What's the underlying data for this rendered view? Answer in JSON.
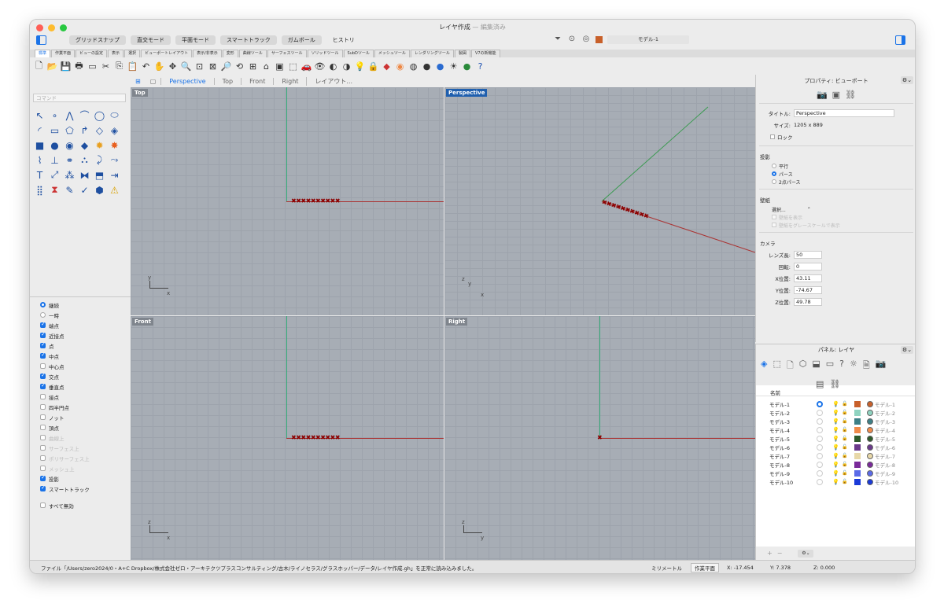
{
  "window": {
    "title": "レイヤ作成",
    "subtitle": "— 編集済み"
  },
  "modes": [
    "グリッドスナップ",
    "直交モード",
    "平面モード",
    "スマートトラック",
    "ガムボール"
  ],
  "history_label": "ヒストリ",
  "current_layer": "モデル-1",
  "tabs": [
    "標準",
    "作業平面",
    "ビューの設定",
    "表示",
    "選択",
    "ビューポートレイアウト",
    "表示/非表示",
    "変形",
    "曲線ツール",
    "サーフェスツール",
    "ソリッドツール",
    "SubDツール",
    "メッシュツール",
    "レンダリングツール",
    "製図",
    "V7の新機能"
  ],
  "command_placeholder": "コマンド",
  "viewport_tabs": [
    "Perspective",
    "Top",
    "Front",
    "Right",
    "レイアウト..."
  ],
  "viewports": {
    "top": "Top",
    "perspective": "Perspective",
    "front": "Front",
    "right": "Right"
  },
  "gizmo": {
    "top": [
      "y",
      "x"
    ],
    "persp": [
      "z",
      "y",
      "x"
    ],
    "front": [
      "z",
      "x"
    ],
    "right": [
      "z",
      "y"
    ]
  },
  "osnap": [
    {
      "label": "継続",
      "type": "radio",
      "on": true
    },
    {
      "label": "一時",
      "type": "radio",
      "on": false
    },
    {
      "label": "端点",
      "type": "check",
      "on": true
    },
    {
      "label": "近接点",
      "type": "check",
      "on": true
    },
    {
      "label": "点",
      "type": "check",
      "on": true
    },
    {
      "label": "中点",
      "type": "check",
      "on": true
    },
    {
      "label": "中心点",
      "type": "check",
      "on": false
    },
    {
      "label": "交点",
      "type": "check",
      "on": true
    },
    {
      "label": "垂直点",
      "type": "check",
      "on": true
    },
    {
      "label": "接点",
      "type": "check",
      "on": false
    },
    {
      "label": "四半円点",
      "type": "check",
      "on": false
    },
    {
      "label": "ノット",
      "type": "check",
      "on": false
    },
    {
      "label": "頂点",
      "type": "check",
      "on": false
    },
    {
      "label": "曲線上",
      "type": "check",
      "on": false,
      "dim": true
    },
    {
      "label": "サーフェス上",
      "type": "check",
      "on": false,
      "dim": true
    },
    {
      "label": "ポリサーフェス上",
      "type": "check",
      "on": false,
      "dim": true
    },
    {
      "label": "メッシュ上",
      "type": "check",
      "on": false,
      "dim": true
    },
    {
      "label": "投影",
      "type": "check",
      "on": true
    },
    {
      "label": "スマートトラック",
      "type": "check",
      "on": true
    }
  ],
  "osnap_disable_all": "すべて無効",
  "properties": {
    "header": "プロパティ: ビューポート",
    "title_label": "タイトル:",
    "title_value": "Perspective",
    "size_label": "サイズ:",
    "size_value": "1205 x 889",
    "lock_label": "ロック",
    "projection_label": "投影",
    "proj_parallel": "平行",
    "proj_perspective": "パース",
    "proj_twopoint": "2点パース",
    "wallpaper_label": "壁紙",
    "wallpaper_select": "選択...",
    "wallpaper_show": "壁紙を表示",
    "wallpaper_gray": "壁紙をグレースケールで表示",
    "camera_label": "カメラ",
    "lens_label": "レンズ長:",
    "lens_value": "50",
    "rotation_label": "回転:",
    "rotation_value": "0",
    "xpos_label": "X位置:",
    "xpos_value": "43.11",
    "ypos_label": "Y位置:",
    "ypos_value": "-74.67",
    "zpos_label": "Z位置:",
    "zpos_value": "49.78"
  },
  "layers_panel": {
    "header": "パネル: レイヤ",
    "col_name": "名前",
    "rows": [
      {
        "name": "モデル-1",
        "color": "#c8602a",
        "mat": "#c8602a",
        "current": true
      },
      {
        "name": "モデル-2",
        "color": "#8fd3c0",
        "mat": "#8fd3c0"
      },
      {
        "name": "モデル-3",
        "color": "#3d7f86",
        "mat": "#3d7f86"
      },
      {
        "name": "モデル-4",
        "color": "#f08a4a",
        "mat": "#f08a4a"
      },
      {
        "name": "モデル-5",
        "color": "#2e5a2a",
        "mat": "#2e5a2a"
      },
      {
        "name": "モデル-6",
        "color": "#6a3a8a",
        "mat": "#6a3a8a"
      },
      {
        "name": "モデル-7",
        "color": "#e8d8a8",
        "mat": "#e8d8a8"
      },
      {
        "name": "モデル-8",
        "color": "#7a2a9a",
        "mat": "#7a2a9a"
      },
      {
        "name": "モデル-9",
        "color": "#5a6ae8",
        "mat": "#5a6ae8"
      },
      {
        "name": "モデル-10",
        "color": "#1a3ad8",
        "mat": "#1a3ad8"
      }
    ]
  },
  "status": {
    "message": "ファイル「/Users/zero2024/0・A+C Dropbox/株式会社ゼロ・アーキテクツプラスコンサルティング/古木/ライノセラス/グラスホッパー/データ/レイヤ作成.gh」を正常に読み込みました。",
    "units": "ミリメートル",
    "cplane": "作業平面",
    "x": "X: -17.454",
    "y": "Y: 7.378",
    "z": "Z: 0.000"
  },
  "crosses": "✖✖✖✖✖✖✖✖✖✖"
}
